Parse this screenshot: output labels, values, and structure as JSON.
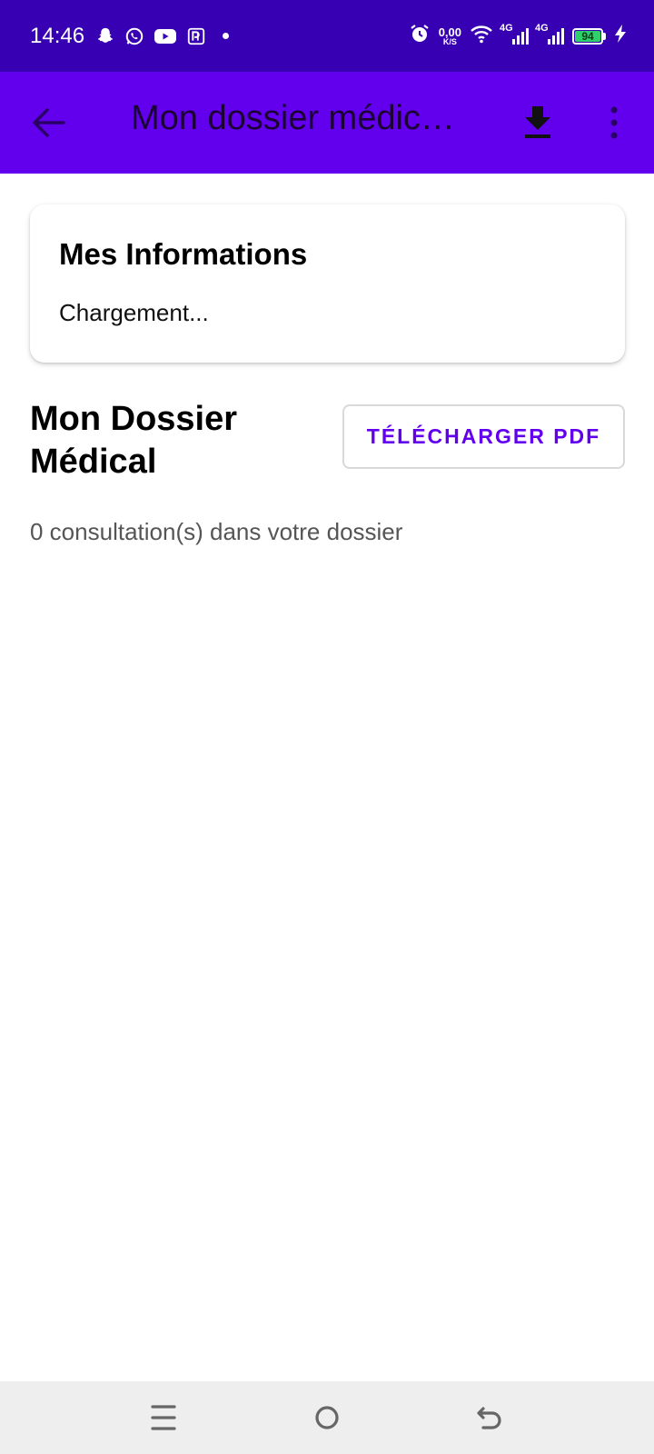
{
  "status_bar": {
    "time": "14:46",
    "net_speed_value": "0,00",
    "net_speed_unit": "K/S",
    "signal1_label": "4G",
    "signal2_label": "4G",
    "battery_level": "94",
    "notification_icons": [
      "snapchat-icon",
      "whatsapp-icon",
      "youtube-icon",
      "paypal-icon"
    ],
    "system_icons": [
      "alarm-icon",
      "wifi-icon",
      "signal-icon",
      "battery-icon",
      "charging-icon"
    ]
  },
  "app_bar": {
    "title": "Mon dossier médic…",
    "background": "#6200ee",
    "status_background": "#3700b3"
  },
  "info_card": {
    "heading": "Mes Informations",
    "loading_text": "Chargement..."
  },
  "dossier": {
    "title_line1": "Mon Dossier",
    "title_line2": "Médical",
    "pdf_button_label": "TÉLÉCHARGER PDF",
    "consultation_count_text": "0 consultation(s) dans votre dossier",
    "accent_color": "#6200ee"
  },
  "nav_bar": {
    "buttons": [
      "menu-icon",
      "home-icon",
      "back-icon"
    ]
  }
}
